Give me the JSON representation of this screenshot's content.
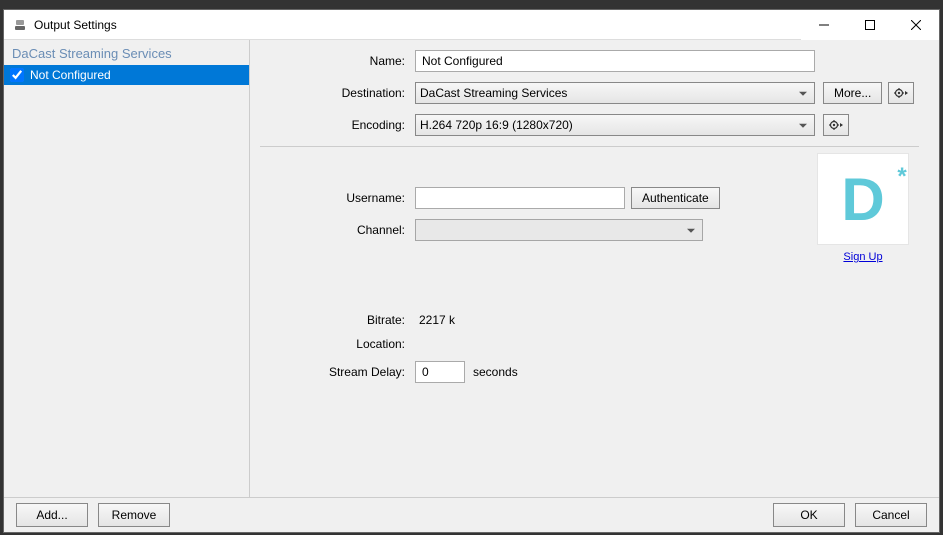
{
  "window": {
    "title": "Output Settings"
  },
  "sidebar": {
    "header": "DaCast Streaming Services",
    "items": [
      {
        "label": "Not Configured",
        "checked": true,
        "selected": true
      }
    ]
  },
  "form": {
    "name_label": "Name:",
    "name_value": "Not Configured",
    "destination_label": "Destination:",
    "destination_value": "DaCast Streaming Services",
    "more_label": "More...",
    "encoding_label": "Encoding:",
    "encoding_value": "H.264 720p 16:9 (1280x720)",
    "username_label": "Username:",
    "username_value": "",
    "authenticate_label": "Authenticate",
    "channel_label": "Channel:",
    "channel_value": "",
    "signup_label": "Sign Up",
    "bitrate_label": "Bitrate:",
    "bitrate_value": "2217 k",
    "location_label": "Location:",
    "location_value": "",
    "stream_delay_label": "Stream Delay:",
    "stream_delay_value": "0",
    "stream_delay_unit": "seconds"
  },
  "footer": {
    "add_label": "Add...",
    "remove_label": "Remove",
    "ok_label": "OK",
    "cancel_label": "Cancel"
  },
  "logo": {
    "letter": "D",
    "accent": "*"
  }
}
